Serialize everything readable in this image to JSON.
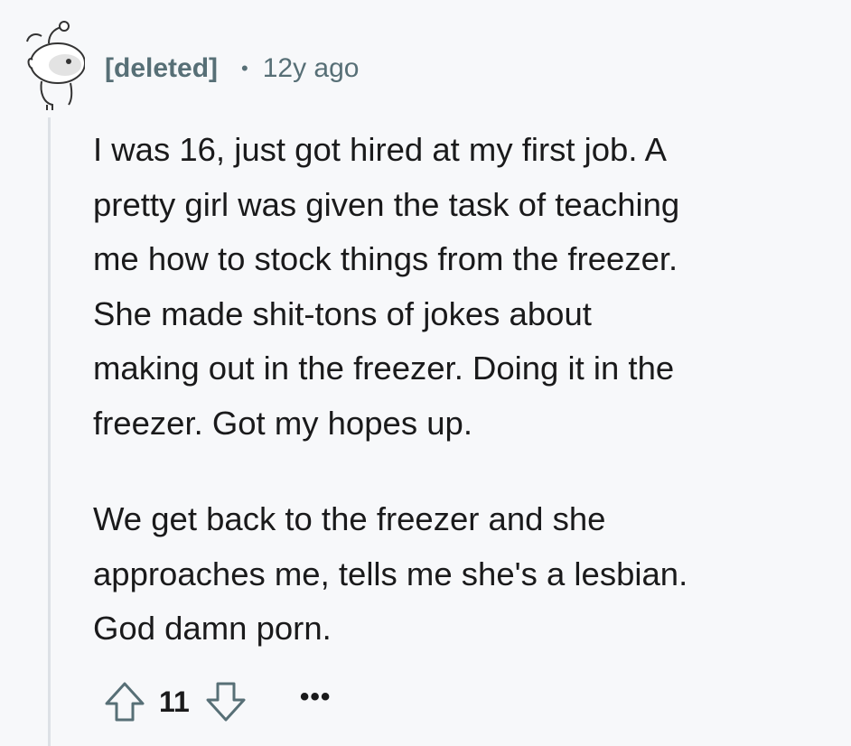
{
  "comment": {
    "author": "[deleted]",
    "separator": "•",
    "age": "12y ago",
    "avatar_icon": "snoo-avatar-icon",
    "paragraphs": [
      "I was 16, just got hired at my first job. A\npretty girl was given the task of teaching\nme how to stock things from the freezer.\nShe made shit-tons of jokes about\nmaking out in the freezer. Doing it in the\nfreezer. Got my hopes up.",
      "We get back to the freezer and she\napproaches me, tells me she's a lesbian.\nGod damn porn."
    ],
    "actions": {
      "upvote_icon": "upvote-arrow-icon",
      "score": "11",
      "downvote_icon": "downvote-arrow-icon",
      "more_label": "•••"
    }
  },
  "colors": {
    "background": "#f7f8fa",
    "meta_text": "#576f76",
    "body_text": "#1a1a1b",
    "thread_line": "#dde1e6"
  }
}
